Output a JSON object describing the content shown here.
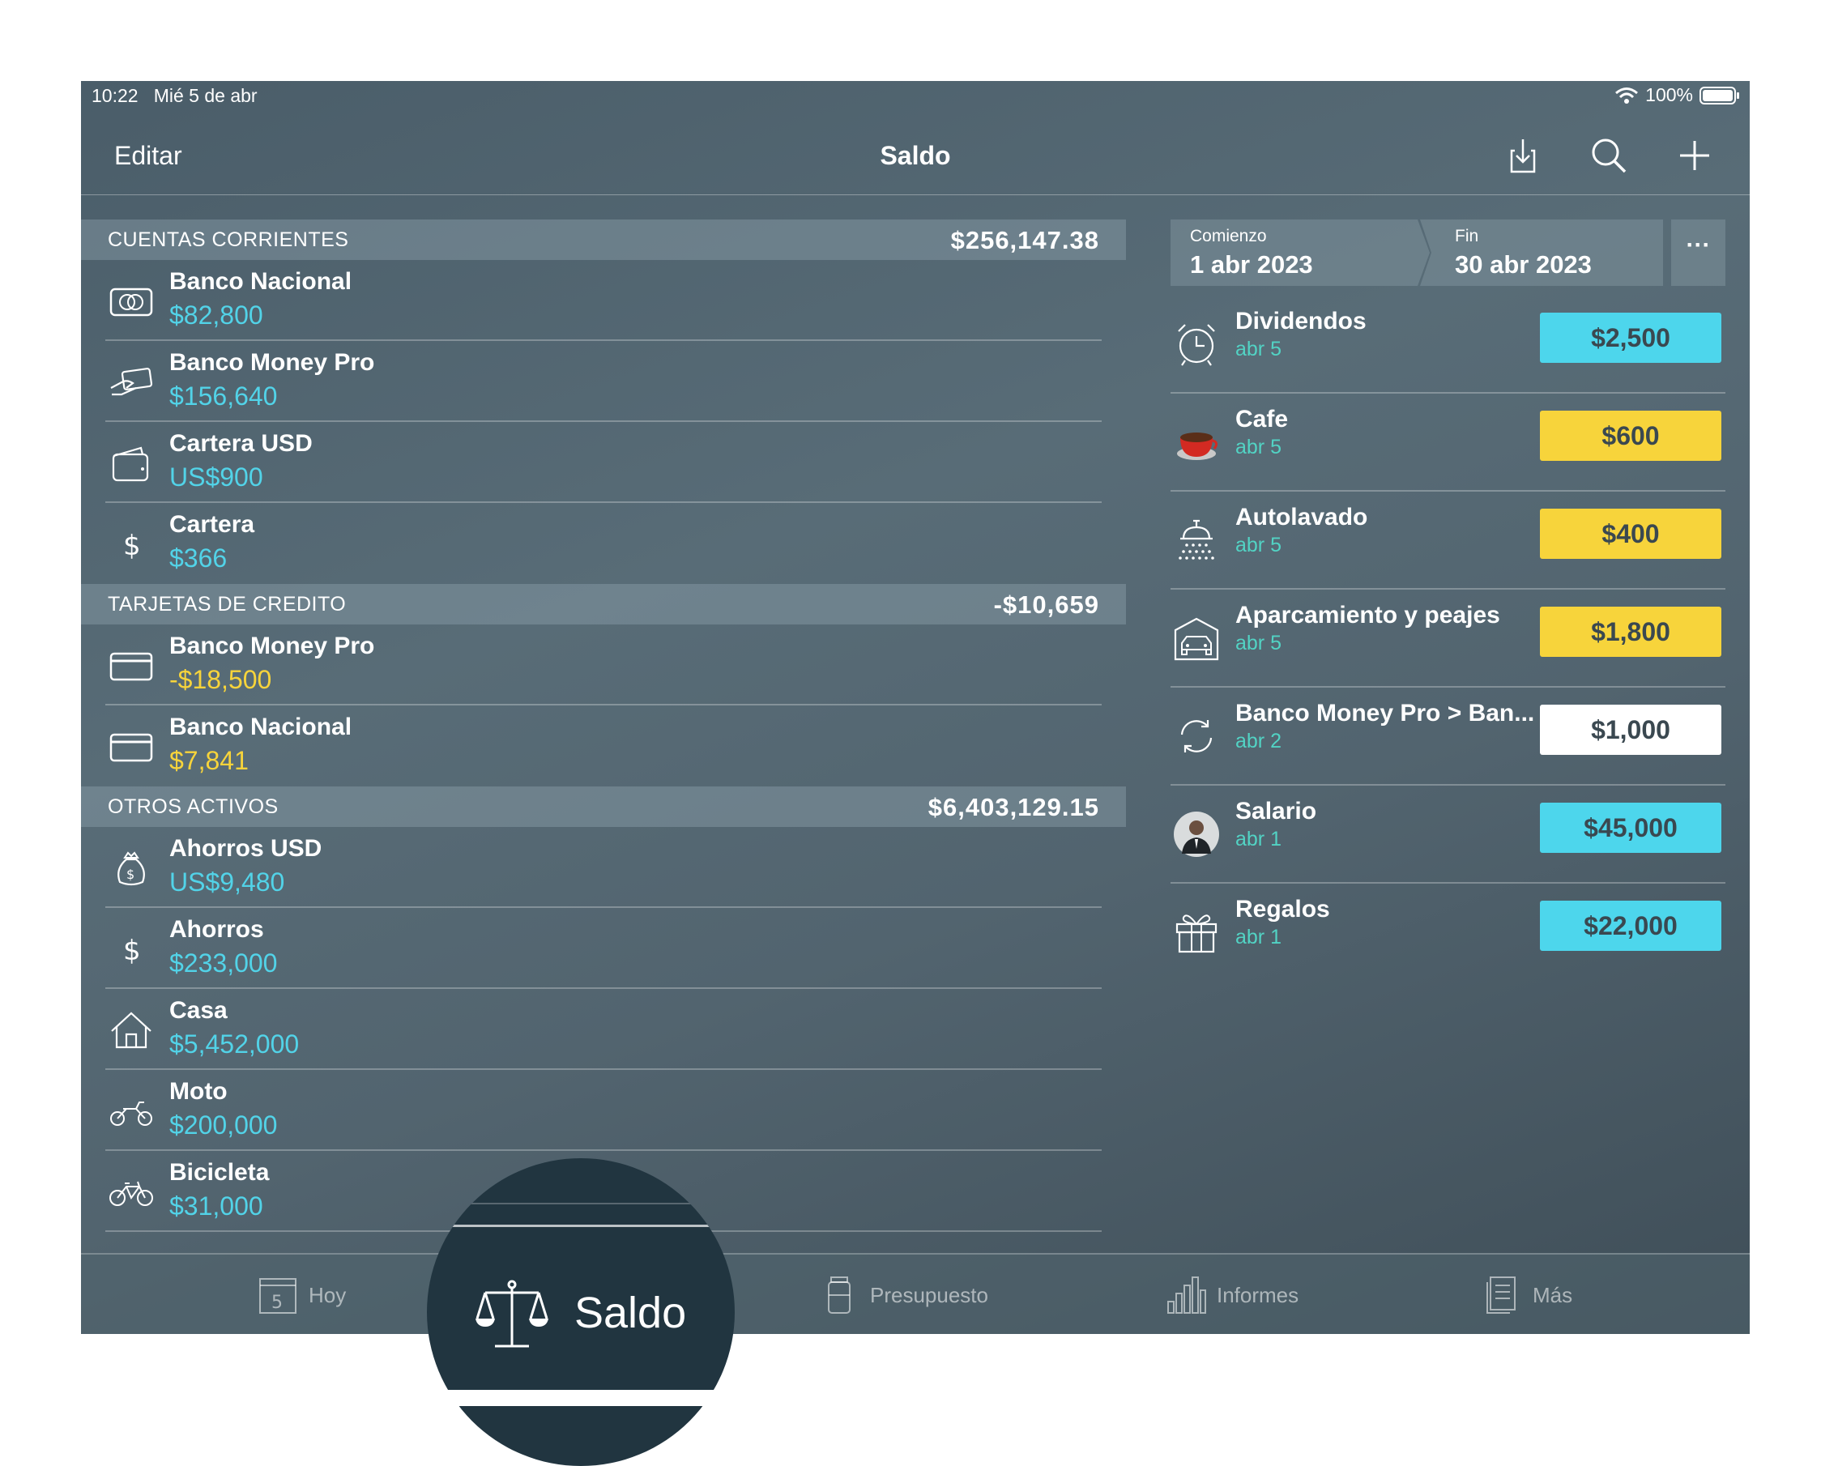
{
  "status": {
    "time": "10:22",
    "date": "Mié 5 de abr",
    "battery": "100%"
  },
  "nav": {
    "edit": "Editar",
    "title": "Saldo"
  },
  "sections": [
    {
      "title": "CUENTAS CORRIENTES",
      "total": "$256,147.38",
      "accounts": [
        {
          "name": "Banco Nacional",
          "amount": "$82,800",
          "color": "cyan",
          "icon": "credit-card-chip-icon"
        },
        {
          "name": "Banco Money Pro",
          "amount": "$156,640",
          "color": "cyan",
          "icon": "hand-card-icon"
        },
        {
          "name": "Cartera USD",
          "amount": "US$900",
          "color": "cyan",
          "icon": "wallet-icon"
        },
        {
          "name": "Cartera",
          "amount": "$366",
          "color": "cyan",
          "icon": "dollar-icon"
        }
      ]
    },
    {
      "title": "TARJETAS DE CREDITO",
      "total": "-$10,659",
      "accounts": [
        {
          "name": "Banco Money Pro",
          "amount": "-$18,500",
          "color": "yellow",
          "icon": "credit-card-icon"
        },
        {
          "name": "Banco Nacional",
          "amount": "$7,841",
          "color": "yellow",
          "icon": "credit-card-icon"
        }
      ]
    },
    {
      "title": "OTROS ACTIVOS",
      "total": "$6,403,129.15",
      "accounts": [
        {
          "name": "Ahorros USD",
          "amount": "US$9,480",
          "color": "cyan",
          "icon": "money-bag-icon"
        },
        {
          "name": "Ahorros",
          "amount": "$233,000",
          "color": "cyan",
          "icon": "dollar-icon"
        },
        {
          "name": "Casa",
          "amount": "$5,452,000",
          "color": "cyan",
          "icon": "house-icon"
        },
        {
          "name": "Moto",
          "amount": "$200,000",
          "color": "cyan",
          "icon": "motorcycle-icon"
        },
        {
          "name": "Bicicleta",
          "amount": "$31,000",
          "color": "cyan",
          "icon": "bicycle-icon"
        }
      ]
    }
  ],
  "period": {
    "start_label": "Comienzo",
    "start_value": "1 abr 2023",
    "end_label": "Fin",
    "end_value": "30 abr 2023",
    "more": "···"
  },
  "transactions": [
    {
      "name": "Dividendos",
      "date": "abr 5",
      "amount": "$2,500",
      "style": "cyan",
      "icon": "alarm-clock-icon"
    },
    {
      "name": "Cafe",
      "date": "abr 5",
      "amount": "$600",
      "style": "yellow",
      "icon": "coffee-cup-icon"
    },
    {
      "name": "Autolavado",
      "date": "abr 5",
      "amount": "$400",
      "style": "yellow",
      "icon": "shower-icon"
    },
    {
      "name": "Aparcamiento y peajes",
      "date": "abr 5",
      "amount": "$1,800",
      "style": "yellow",
      "icon": "garage-car-icon"
    },
    {
      "name": "Banco Money Pro > Ban...",
      "date": "abr 2",
      "amount": "$1,000",
      "style": "white",
      "icon": "transfer-icon"
    },
    {
      "name": "Salario",
      "date": "abr 1",
      "amount": "$45,000",
      "style": "cyan",
      "icon": "person-avatar-icon"
    },
    {
      "name": "Regalos",
      "date": "abr 1",
      "amount": "$22,000",
      "style": "cyan",
      "icon": "gift-icon"
    }
  ],
  "tabs": {
    "hoy": "Hoy",
    "hoy_day": "5",
    "saldo": "Saldo",
    "presupuesto": "Presupuesto",
    "informes": "Informes",
    "mas": "Más"
  },
  "colors": {
    "cyan": "#52d3e8",
    "yellow": "#f7d43b",
    "date_green": "#52d3c4"
  }
}
